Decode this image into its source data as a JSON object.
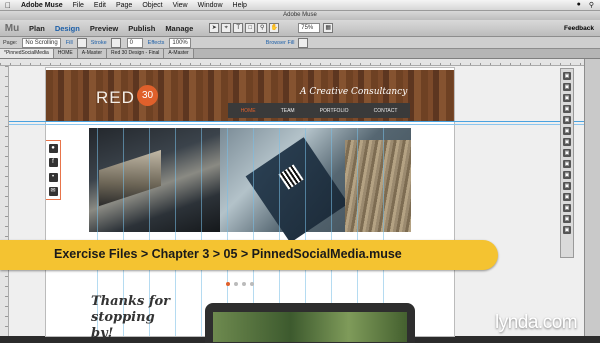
{
  "menubar": {
    "app": "Adobe Muse",
    "items": [
      "File",
      "Edit",
      "Page",
      "Object",
      "View",
      "Window",
      "Help"
    ]
  },
  "window": {
    "title": "Adobe Muse"
  },
  "toolbar": {
    "logo": "Mu",
    "modes": [
      "Plan",
      "Design",
      "Preview",
      "Publish",
      "Manage"
    ],
    "active_mode": "Design",
    "zoom": "75%",
    "feedback": "Feedback"
  },
  "controlbar": {
    "page_label": "Page:",
    "page_value": "No Scrolling",
    "fill": "Fill",
    "stroke": "Stroke",
    "effects": "Effects",
    "opacity": "100%",
    "browser_fill": "Browser Fill"
  },
  "tabs": [
    "*PinnedSocialMedia",
    "HOME",
    "A-Master",
    "Red 30 Design - Final",
    "A-Master"
  ],
  "site": {
    "logo_text": "RED",
    "logo_number": "30",
    "tagline": "A Creative Consultancy",
    "nav": [
      "HOME",
      "TEAM",
      "PORTFOLIO",
      "CONTACT"
    ],
    "thanks": "Thanks for stopping by!"
  },
  "banner": {
    "text": "Exercise Files > Chapter 3 > 05 > PinnedSocialMedia.muse"
  },
  "watermark": {
    "text": "lynda.com"
  },
  "colors": {
    "accent": "#e0602b",
    "banner": "#f4c331",
    "mode_active": "#1c5fa8"
  }
}
